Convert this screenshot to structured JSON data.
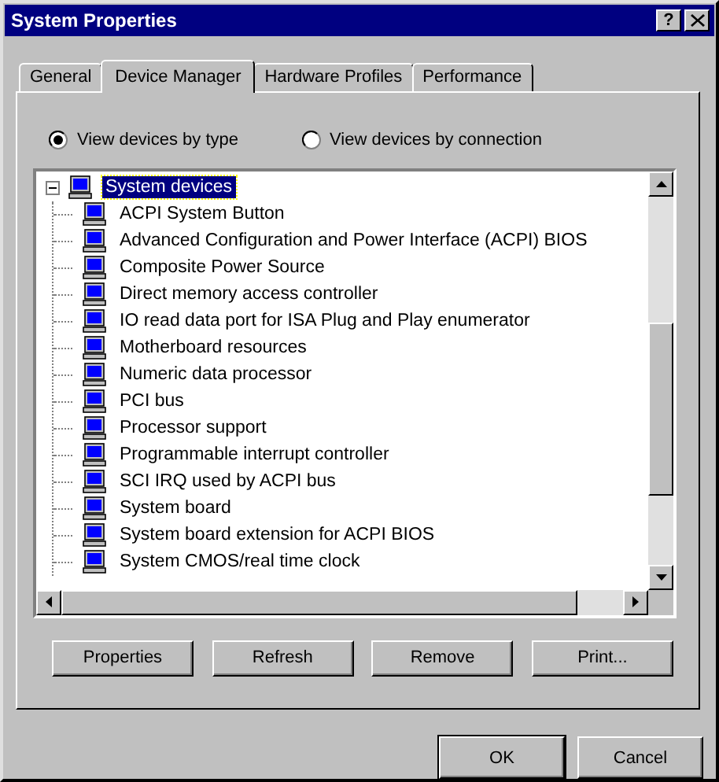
{
  "window": {
    "title": "System Properties",
    "help_button": "?"
  },
  "tabs": [
    {
      "label": "General",
      "selected": false
    },
    {
      "label": "Device Manager",
      "selected": true
    },
    {
      "label": "Hardware Profiles",
      "selected": false
    },
    {
      "label": "Performance",
      "selected": false
    }
  ],
  "view_options": [
    {
      "label": "View devices by type",
      "selected": true
    },
    {
      "label": "View devices by connection",
      "selected": false
    }
  ],
  "tree": [
    {
      "label": "System devices",
      "expanded": true,
      "selected": true,
      "children": [
        {
          "label": "ACPI System Button",
          "selected": false
        },
        {
          "label": "Advanced Configuration and Power Interface (ACPI) BIOS",
          "selected": false
        },
        {
          "label": "Composite Power Source",
          "selected": false
        },
        {
          "label": "Direct memory access controller",
          "selected": false
        },
        {
          "label": "IO read data port for ISA Plug and Play enumerator",
          "selected": false
        },
        {
          "label": "Motherboard resources",
          "selected": false
        },
        {
          "label": "Numeric data processor",
          "selected": false
        },
        {
          "label": "PCI bus",
          "selected": false
        },
        {
          "label": "Processor support",
          "selected": false
        },
        {
          "label": "Programmable interrupt controller",
          "selected": false
        },
        {
          "label": "SCI IRQ used by ACPI bus",
          "selected": false
        },
        {
          "label": "System board",
          "selected": false
        },
        {
          "label": "System board extension for ACPI BIOS",
          "selected": false
        },
        {
          "label": "System CMOS/real time clock",
          "selected": false
        }
      ]
    }
  ],
  "buttons": [
    "Properties",
    "Refresh",
    "Remove",
    "Print..."
  ],
  "dialog_buttons": [
    "OK",
    "Cancel"
  ]
}
